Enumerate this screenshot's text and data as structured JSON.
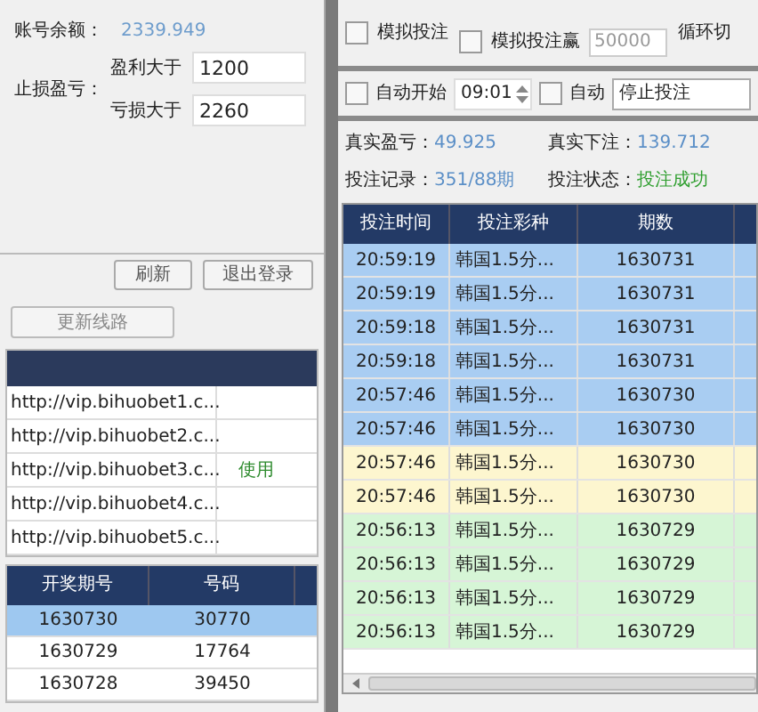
{
  "account": {
    "balance_label": "账号余额：",
    "balance": "2339.949",
    "stoploss_label": "止损盈亏：",
    "profit_label": "盈利大于",
    "profit": "1200",
    "loss_label": "亏损大于",
    "loss": "2260"
  },
  "left_buttons": [
    "刷新",
    "退出登录"
  ],
  "update_button": "更新线路",
  "routes": [
    {
      "url": "http://vip.bihuobet1.c..."
    },
    {
      "url": "http://vip.bihuobet2.c..."
    },
    {
      "url": "http://vip.bihuobet3.c...",
      "status": "使用"
    },
    {
      "url": "http://vip.bihuobet4.c..."
    },
    {
      "url": "http://vip.bihuobet5.c..."
    }
  ],
  "draws": {
    "columns": [
      "开奖期号",
      "号码"
    ],
    "rows": [
      {
        "issue": "1630730",
        "number": "30770",
        "selected": true
      },
      {
        "issue": "1630729",
        "number": "17764",
        "selected": false
      },
      {
        "issue": "1630728",
        "number": "39450",
        "selected": false
      }
    ]
  },
  "simulation": {
    "bet": {
      "label": "模拟投注",
      "checked": false
    },
    "win": {
      "label": "模拟投注赢",
      "checked": false,
      "value": "50000"
    },
    "cycle_label": "循环切"
  },
  "auto": {
    "start": {
      "label": "自动开始",
      "checked": false
    },
    "time": "09:01",
    "auto": {
      "label": "自动",
      "checked": false
    },
    "mode": "停止投注"
  },
  "stats": [
    {
      "label": "真实盈亏：",
      "value": "49.925",
      "color": "#5b8fc7"
    },
    {
      "label": "真实下注：",
      "value": "139.712",
      "color": "#5b8fc7"
    },
    {
      "label": "投注记录：",
      "value": "351/88期",
      "color": "#5b8fc7"
    },
    {
      "label": "投注状态：",
      "value": "投注成功",
      "color": "#2e9e2e"
    }
  ],
  "bets": {
    "columns": [
      "投注时间",
      "投注彩种",
      "期数"
    ],
    "rows": [
      {
        "time": "20:59:19",
        "lottery": "韩国1.5分...",
        "issue": "1630731",
        "color": "#a9cdf2"
      },
      {
        "time": "20:59:19",
        "lottery": "韩国1.5分...",
        "issue": "1630731",
        "color": "#a9cdf2"
      },
      {
        "time": "20:59:18",
        "lottery": "韩国1.5分...",
        "issue": "1630731",
        "color": "#a9cdf2"
      },
      {
        "time": "20:59:18",
        "lottery": "韩国1.5分...",
        "issue": "1630731",
        "color": "#a9cdf2"
      },
      {
        "time": "20:57:46",
        "lottery": "韩国1.5分...",
        "issue": "1630730",
        "color": "#a9cdf2"
      },
      {
        "time": "20:57:46",
        "lottery": "韩国1.5分...",
        "issue": "1630730",
        "color": "#a9cdf2"
      },
      {
        "time": "20:57:46",
        "lottery": "韩国1.5分...",
        "issue": "1630730",
        "color": "#fdf6cf"
      },
      {
        "time": "20:57:46",
        "lottery": "韩国1.5分...",
        "issue": "1630730",
        "color": "#fdf6cf"
      },
      {
        "time": "20:56:13",
        "lottery": "韩国1.5分...",
        "issue": "1630729",
        "color": "#d6f5d6"
      },
      {
        "time": "20:56:13",
        "lottery": "韩国1.5分...",
        "issue": "1630729",
        "color": "#d6f5d6"
      },
      {
        "time": "20:56:13",
        "lottery": "韩国1.5分...",
        "issue": "1630729",
        "color": "#d6f5d6"
      },
      {
        "time": "20:56:13",
        "lottery": "韩国1.5分...",
        "issue": "1630729",
        "color": "#d6f5d6"
      }
    ]
  }
}
